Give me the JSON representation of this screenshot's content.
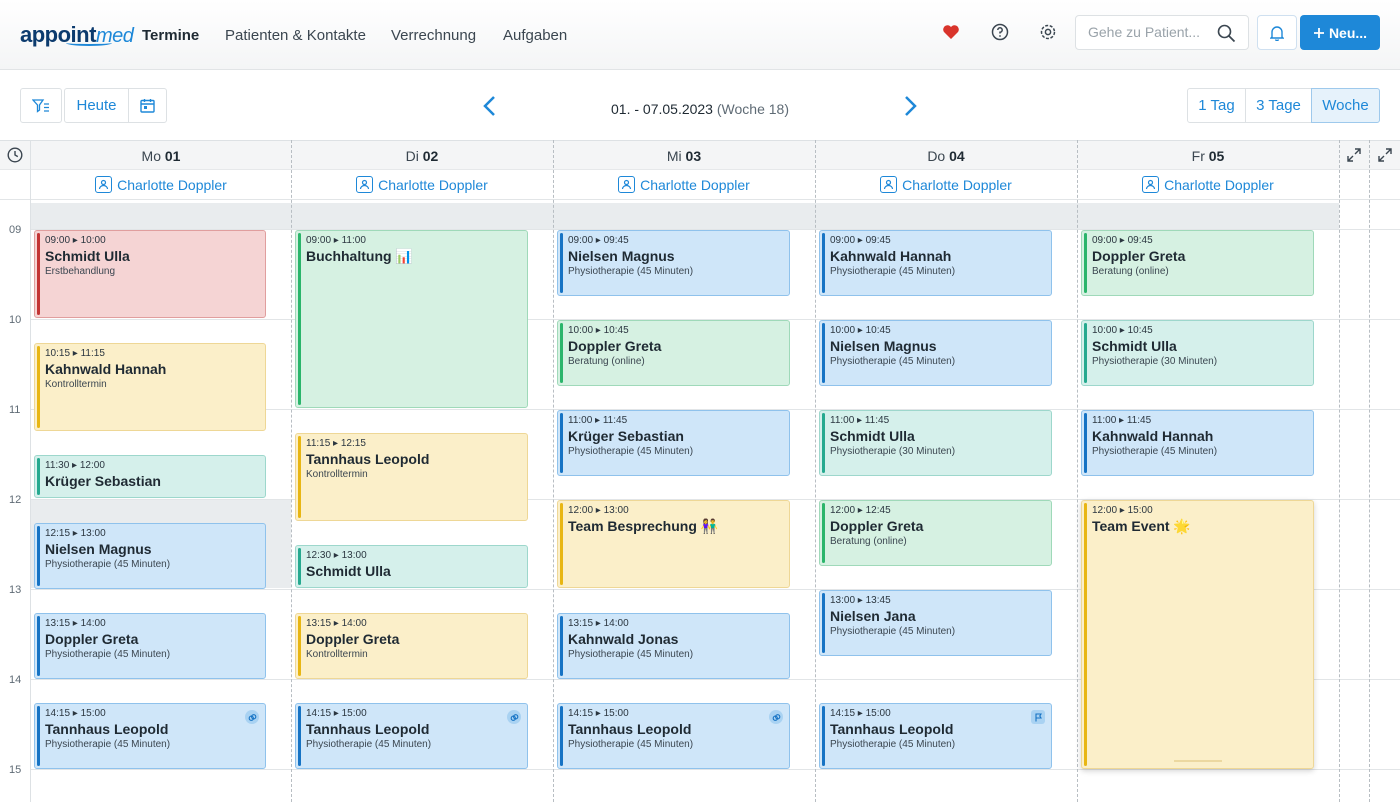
{
  "header": {
    "logo_main": "appoint",
    "logo_accent": "med",
    "nav": [
      "Termine",
      "Patienten & Kontakte",
      "Verrechnung",
      "Aufgaben"
    ],
    "search_placeholder": "Gehe zu Patient...",
    "new_button": "Neu..."
  },
  "toolbar": {
    "today": "Heute",
    "range_bold": "01. - 07.05.2023",
    "range_week": "(Woche 18)",
    "views": [
      "1 Tag",
      "3 Tage",
      "Woche"
    ]
  },
  "calendar": {
    "days": [
      {
        "dow": "Mo",
        "num": "01"
      },
      {
        "dow": "Di",
        "num": "02"
      },
      {
        "dow": "Mi",
        "num": "03"
      },
      {
        "dow": "Do",
        "num": "04"
      },
      {
        "dow": "Fr",
        "num": "05"
      }
    ],
    "resource": "Charlotte Doppler",
    "hours": [
      "09",
      "10",
      "11",
      "12",
      "13",
      "14",
      "15"
    ]
  },
  "events": [
    {
      "time": "09:00 ▸ 10:00",
      "title": "Schmidt Ulla",
      "sub": "Erstbehandlung"
    },
    {
      "time": "10:15 ▸ 11:15",
      "title": "Kahnwald Hannah",
      "sub": "Kontrolltermin"
    },
    {
      "time": "11:30 ▸ 12:00",
      "title": "Krüger Sebastian",
      "sub": ""
    },
    {
      "time": "12:15 ▸ 13:00",
      "title": "Nielsen Magnus",
      "sub": "Physiotherapie (45 Minuten)"
    },
    {
      "time": "13:15 ▸ 14:00",
      "title": "Doppler Greta",
      "sub": "Physiotherapie (45 Minuten)"
    },
    {
      "time": "14:15 ▸ 15:00",
      "title": "Tannhaus Leopold",
      "sub": "Physiotherapie (45 Minuten)"
    },
    {
      "time": "09:00 ▸ 11:00",
      "title": "Buchhaltung 📊",
      "sub": ""
    },
    {
      "time": "11:15 ▸ 12:15",
      "title": "Tannhaus Leopold",
      "sub": "Kontrolltermin"
    },
    {
      "time": "12:30 ▸ 13:00",
      "title": "Schmidt Ulla",
      "sub": ""
    },
    {
      "time": "13:15 ▸ 14:00",
      "title": "Doppler Greta",
      "sub": "Kontrolltermin"
    },
    {
      "time": "14:15 ▸ 15:00",
      "title": "Tannhaus Leopold",
      "sub": "Physiotherapie (45 Minuten)"
    },
    {
      "time": "09:00 ▸ 09:45",
      "title": "Nielsen Magnus",
      "sub": "Physiotherapie (45 Minuten)"
    },
    {
      "time": "10:00 ▸ 10:45",
      "title": "Doppler Greta",
      "sub": "Beratung (online)"
    },
    {
      "time": "11:00 ▸ 11:45",
      "title": "Krüger Sebastian",
      "sub": "Physiotherapie (45 Minuten)"
    },
    {
      "time": "12:00 ▸ 13:00",
      "title": "Team Besprechung 👫",
      "sub": ""
    },
    {
      "time": "13:15 ▸ 14:00",
      "title": "Kahnwald Jonas",
      "sub": "Physiotherapie (45 Minuten)"
    },
    {
      "time": "14:15 ▸ 15:00",
      "title": "Tannhaus Leopold",
      "sub": "Physiotherapie (45 Minuten)"
    },
    {
      "time": "09:00 ▸ 09:45",
      "title": "Kahnwald Hannah",
      "sub": "Physiotherapie (45 Minuten)"
    },
    {
      "time": "10:00 ▸ 10:45",
      "title": "Nielsen Magnus",
      "sub": "Physiotherapie (45 Minuten)"
    },
    {
      "time": "11:00 ▸ 11:45",
      "title": "Schmidt Ulla",
      "sub": "Physiotherapie (30 Minuten)"
    },
    {
      "time": "12:00 ▸ 12:45",
      "title": "Doppler Greta",
      "sub": "Beratung (online)"
    },
    {
      "time": "13:00 ▸ 13:45",
      "title": "Nielsen Jana",
      "sub": "Physiotherapie (45 Minuten)"
    },
    {
      "time": "14:15 ▸ 15:00",
      "title": "Tannhaus Leopold",
      "sub": "Physiotherapie (45 Minuten)"
    },
    {
      "time": "09:00 ▸ 09:45",
      "title": "Doppler Greta",
      "sub": "Beratung (online)"
    },
    {
      "time": "10:00 ▸ 10:45",
      "title": "Schmidt Ulla",
      "sub": "Physiotherapie (30 Minuten)"
    },
    {
      "time": "11:00 ▸ 11:45",
      "title": "Kahnwald Hannah",
      "sub": "Physiotherapie (45 Minuten)"
    },
    {
      "time": "12:00 ▸ 15:00",
      "title": "Team Event 🌟",
      "sub": ""
    }
  ],
  "colors": {
    "accent": "#1e88d8",
    "heart": "#d9342b"
  },
  "icons": [
    "heart-icon",
    "help-icon",
    "gear-icon",
    "search-icon",
    "bell-icon",
    "plus-icon",
    "filter-icon",
    "calendar-icon",
    "chevron-left-icon",
    "chevron-right-icon",
    "clock-icon",
    "expand-icon",
    "person-icon",
    "link-icon",
    "flag-icon"
  ]
}
